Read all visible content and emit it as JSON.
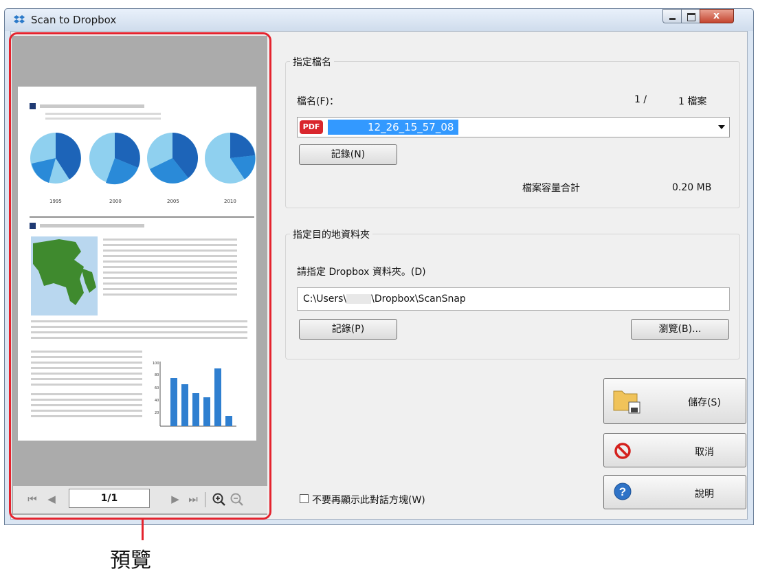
{
  "window": {
    "title": "Scan to Dropbox",
    "callout_label": "預覽"
  },
  "preview": {
    "page_indicator": "1/1",
    "chart_years": [
      "1995",
      "2000",
      "2005",
      "2010"
    ],
    "bar_axis_ticks": [
      "100",
      "80",
      "60",
      "40",
      "20"
    ]
  },
  "file_group": {
    "title": "指定檔名",
    "filename_label": "檔名(F)：",
    "count_current": "1 /",
    "count_total": "1 檔案",
    "pdf_badge": "PDF",
    "filename_value": "12_26_15_57_08",
    "record_button": "記錄(N)",
    "size_label": "檔案容量合計",
    "size_value": "0.20 MB"
  },
  "folder_group": {
    "title": "指定目的地資料夾",
    "instruction": "請指定 Dropbox 資料夾。(D)",
    "path_prefix": "C:\\Users\\",
    "path_suffix": "\\Dropbox\\ScanSnap",
    "record_button": "記錄(P)",
    "browse_button": "瀏覽(B)..."
  },
  "actions": {
    "save": "儲存(S)",
    "cancel": "取消",
    "help": "說明"
  },
  "dont_show_label": "不要再顯示此對話方塊(W)"
}
